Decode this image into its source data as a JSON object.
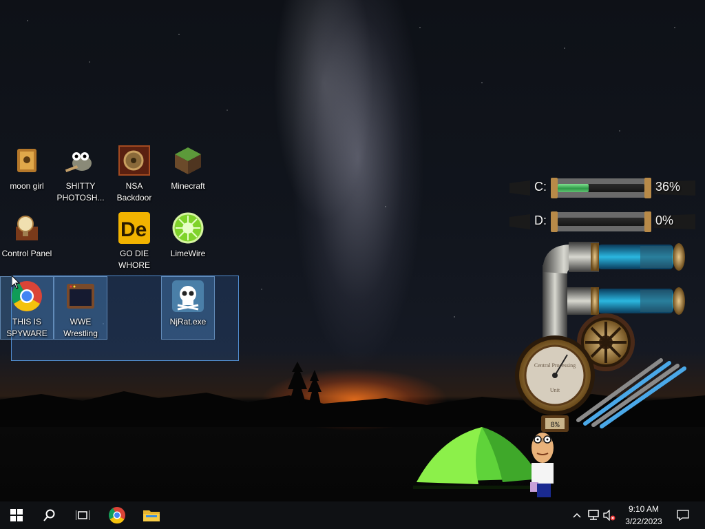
{
  "desktop": {
    "icons": [
      {
        "label": "moon girl"
      },
      {
        "label": "SHITTY PHOTOSH..."
      },
      {
        "label": "NSA Backdoor"
      },
      {
        "label": "Minecraft"
      },
      {
        "label": "Control Panel"
      },
      {
        "label": "GO DIE WHORE"
      },
      {
        "label": "LimeWire"
      },
      {
        "label": "THIS IS SPYWARE"
      },
      {
        "label": "WWE Wrestling"
      },
      {
        "label": "NjRat.exe"
      }
    ]
  },
  "widget": {
    "drives": [
      {
        "label": "C:",
        "percent_text": "36%",
        "fill": 0.36
      },
      {
        "label": "D:",
        "percent_text": "0%",
        "fill": 0.0
      }
    ],
    "cpu_dial_text": "8%",
    "dial_caption_top": "Central Processing",
    "dial_caption_bottom": "Unit"
  },
  "taskbar": {
    "time": "9:10 AM",
    "date": "3/22/2023",
    "items": [
      "start-icon",
      "search-icon",
      "task-view-icon",
      "chrome-icon",
      "file-explorer-icon"
    ],
    "tray": [
      "chevron-up-icon",
      "network-icon",
      "volume-muted-icon",
      "notification-icon"
    ]
  },
  "colors": {
    "selection": "#3c78c8",
    "taskbar": "#0f1114",
    "gauge_fill": "#2f9a48",
    "tube_blue": "#2bb7e0"
  }
}
